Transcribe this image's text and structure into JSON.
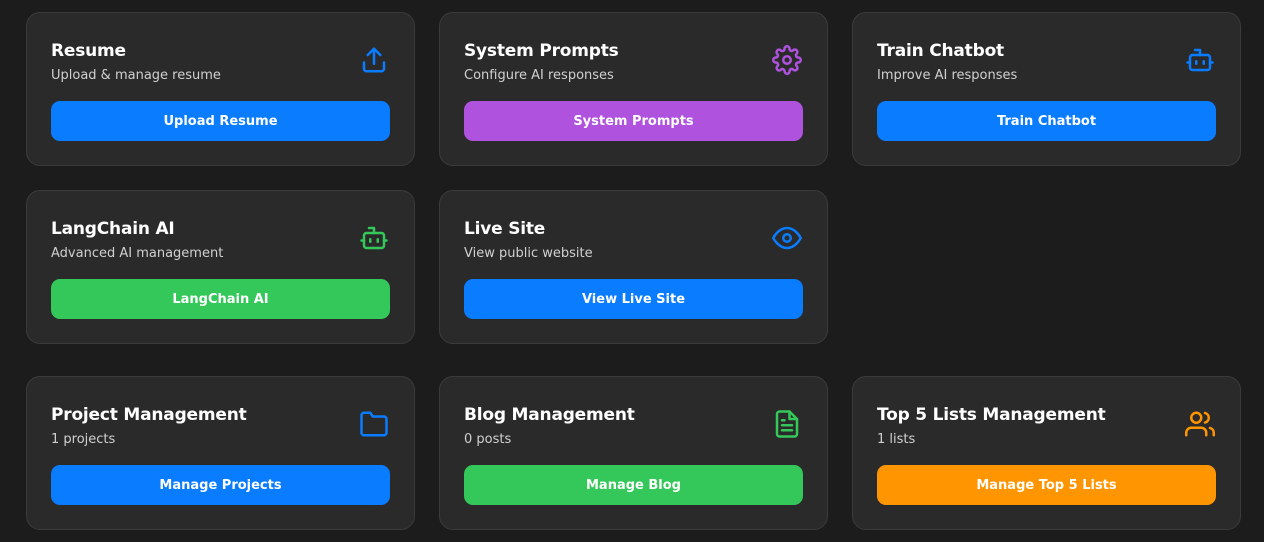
{
  "colors": {
    "blue": "#0a7cff",
    "purple": "#af52de",
    "green": "#34c759",
    "orange": "#ff9500",
    "card_bg": "#2a2a2a",
    "page_bg": "#1c1c1c"
  },
  "cards": {
    "resume": {
      "title": "Resume",
      "subtitle": "Upload & manage resume",
      "button": "Upload Resume",
      "icon": "upload-icon",
      "color": "blue"
    },
    "system_prompts": {
      "title": "System Prompts",
      "subtitle": "Configure AI responses",
      "button": "System Prompts",
      "icon": "gear-icon",
      "color": "purple"
    },
    "train_chatbot": {
      "title": "Train Chatbot",
      "subtitle": "Improve AI responses",
      "button": "Train Chatbot",
      "icon": "robot-icon",
      "color": "blue"
    },
    "langchain": {
      "title": "LangChain AI",
      "subtitle": "Advanced AI management",
      "button": "LangChain AI",
      "icon": "robot-icon",
      "color": "green"
    },
    "live_site": {
      "title": "Live Site",
      "subtitle": "View public website",
      "button": "View Live Site",
      "icon": "eye-icon",
      "color": "blue"
    },
    "projects": {
      "title": "Project Management",
      "subtitle": "1 projects",
      "button": "Manage Projects",
      "icon": "folder-icon",
      "color": "blue"
    },
    "blog": {
      "title": "Blog Management",
      "subtitle": "0 posts",
      "button": "Manage Blog",
      "icon": "document-icon",
      "color": "green"
    },
    "top5": {
      "title": "Top 5 Lists Management",
      "subtitle": "1 lists",
      "button": "Manage Top 5 Lists",
      "icon": "users-icon",
      "color": "orange"
    }
  }
}
